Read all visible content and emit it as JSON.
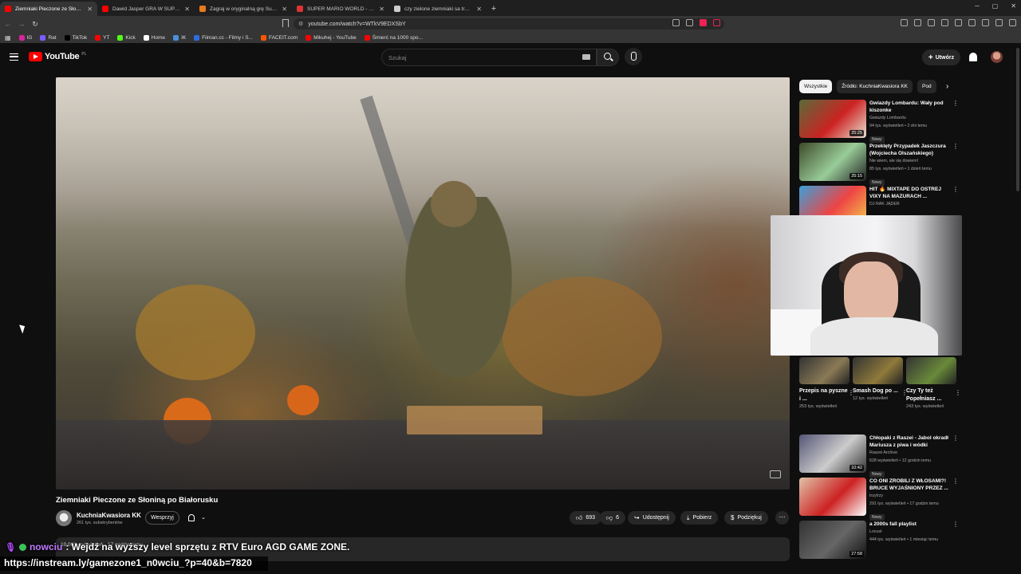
{
  "browser": {
    "tabs": [
      {
        "title": "Ziemniaki Pieczone ze Słoniną",
        "fav": "#ff0000",
        "active": true
      },
      {
        "title": "Dawid Jasper GRA W SUPER MARIO",
        "fav": "#ff0000",
        "active": false
      },
      {
        "title": "Zagraj w oryginalną grę Super Mario",
        "fav": "#e8791d",
        "active": false
      },
      {
        "title": "SUPER MARIO WORLD - Play the ret",
        "fav": "#d33",
        "active": false
      },
      {
        "title": "czy zielone ziemniaki sa trujace - Sz",
        "fav": "#ccc",
        "active": false
      }
    ],
    "url": "youtube.com/watch?v=WTkV9EDXSbY",
    "bookmarks": [
      {
        "label": "IG",
        "color": "#d6249f"
      },
      {
        "label": "Rat",
        "color": "#7a5cff"
      },
      {
        "label": "TikTok",
        "color": "#000000"
      },
      {
        "label": "YT",
        "color": "#ff0000"
      },
      {
        "label": "Kick",
        "color": "#53fc18"
      },
      {
        "label": "Home",
        "color": "#ffffff"
      },
      {
        "label": "Ж",
        "color": "#4a90d9"
      },
      {
        "label": "Filman.cc - Filmy i S...",
        "color": "#2d6cdf"
      },
      {
        "label": "FACEIT.com",
        "color": "#ff5500"
      },
      {
        "label": "Mikuhej - YouTube",
        "color": "#ff0000"
      },
      {
        "label": "Śmierć na 1000 spo...",
        "color": "#ff0000"
      }
    ]
  },
  "youtube": {
    "logo": "YouTube",
    "region": "PL",
    "search_placeholder": "Szukaj",
    "create_label": "Utwórz"
  },
  "video": {
    "title": "Ziemniaki Pieczone ze Słoniną po Białorusku",
    "channel": "KuchniaKwasiora KK",
    "subscribers": "261 tys. subskrybentów",
    "join_label": "Wesprzyj",
    "likes": "693",
    "dislikes": "6",
    "share_label": "Udostępnij",
    "download_label": "Pobierz",
    "thanks_label": "Podziękuj",
    "desc_peek": "10 000 wyświetleń · 17 godzin temu"
  },
  "sidebar": {
    "chips": [
      "Wszystkie",
      "Źródło: KuchniaKwasiora KK",
      "Pod"
    ],
    "recs": [
      {
        "title": "Gwiazdy Lombardu: Wały pod kiszonke",
        "channel": "Gwiazdy Lombardu",
        "views": "94 tys. wyświetleń • 2 dni temu",
        "badge": "Nowy",
        "duration": "25:25",
        "thumb": [
          "#5a6b3a",
          "#c22",
          "#e9e2d2"
        ]
      },
      {
        "title": "Przeklęty Przypadek Jaszczura (Wojciecha Olszańskiego)",
        "channel": "Nie wiem, ale się dowiem!",
        "views": "85 tys. wyświetleń • 1 dzień temu",
        "badge": "Nowy",
        "duration": "25:15",
        "thumb": [
          "#3e4a2a",
          "#9c9",
          "#222"
        ]
      },
      {
        "title": "HIT 🔥 MIXTAPE DO OSTREJ VIXY NA MAZURACH ...",
        "channel": "DJ RAK JĄDER",
        "views": "",
        "badge": "",
        "duration": "",
        "thumb": [
          "#3aa0d8",
          "#e44",
          "#f2c94c"
        ]
      },
      {
        "title": "Chłopaki z Raszei - Jabol okradł Mariusza z piwa i wódki",
        "channel": "Raszei Archive",
        "views": "628 wyświetleń • 12 godzin temu",
        "badge": "Nowy",
        "duration": "10:42",
        "thumb": [
          "#557",
          "#ccc",
          "#333"
        ]
      },
      {
        "title": "CO ONI ZROBILI Z WŁOSAMI?! BRUCE WYJAŚNIONY PRZEZ ...",
        "channel": "trzytrzy",
        "views": "291 tys. wyświetleń • 17 godzin temu",
        "badge": "Nowy",
        "duration": "",
        "thumb": [
          "#e0c2a8",
          "#c22",
          "#fff"
        ]
      },
      {
        "title": "a 2000s fall playlist",
        "channel": "Locust",
        "views": "444 tys. wyświetleń • 1 miesiąc temu",
        "badge": "",
        "duration": "27:58",
        "thumb": [
          "#333",
          "#666",
          "#111"
        ]
      }
    ],
    "shorts": [
      {
        "title": "Przepis na pyszne i ...",
        "views": "253 tys. wyświetleń",
        "color": "#8a7a55"
      },
      {
        "title": "Smash Dog po ...",
        "views": "12 tys. wyświetleń",
        "color": "#8f7a3b"
      },
      {
        "title": "Czy Ty też Popełniasz ...",
        "views": "243 tys. wyświetleń",
        "color": "#6a8a3a"
      }
    ]
  },
  "stream": {
    "nick": "nowciu",
    "message": ": Wejdź na wyższy level sprzętu z RTV Euro AGD GAME ZONE.",
    "url": "https://instream.ly/gamezone1_n0wciu_?p=40&b=7820"
  }
}
